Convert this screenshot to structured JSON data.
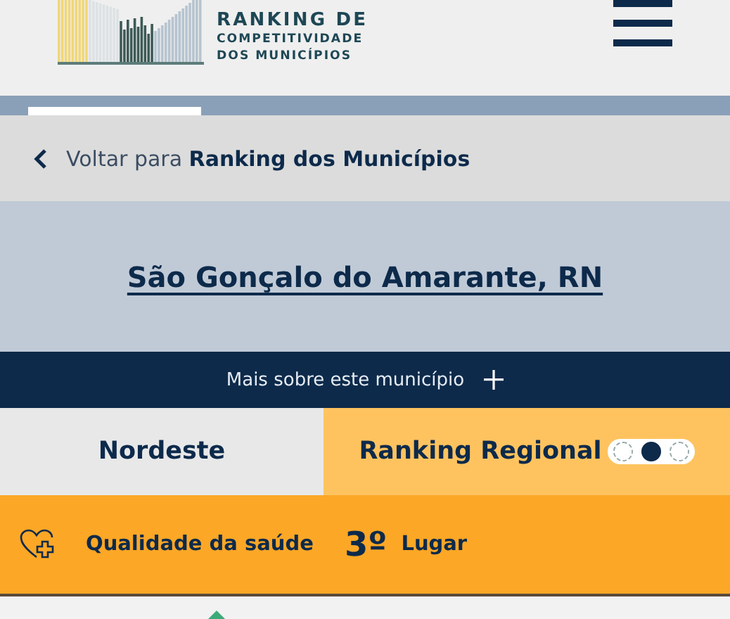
{
  "header": {
    "logo_lines": [
      "RANKING DE",
      "COMPETITIVIDADE",
      "DOS MUNICÍPIOS"
    ]
  },
  "tabs": [
    {
      "selected": true
    }
  ],
  "back_link": {
    "prefix": "Voltar para",
    "target": "Ranking dos Municípios"
  },
  "municipality": {
    "name": "São Gonçalo do Amarante, RN"
  },
  "more_info": {
    "label": "Mais sobre este município",
    "expanded": false
  },
  "region": {
    "name": "Nordeste",
    "ranking_label": "Ranking Regional",
    "toggle": [
      {
        "selected": false
      },
      {
        "selected": true
      },
      {
        "selected": false
      }
    ]
  },
  "pillar": {
    "name": "Qualidade da saúde",
    "position": "3º",
    "position_label": "Lugar"
  }
}
